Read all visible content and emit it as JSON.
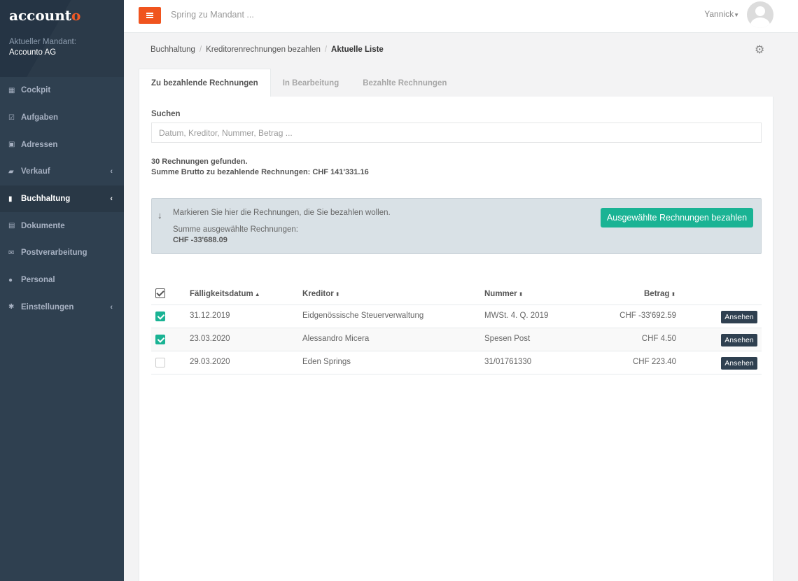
{
  "brand": {
    "logo_main": "account",
    "logo_accent": "o"
  },
  "sidebar": {
    "mandant_label": "Aktueller Mandant:",
    "mandant_name": "Accounto AG",
    "items": [
      {
        "label": "Cockpit",
        "icon": "grid-icon"
      },
      {
        "label": "Aufgaben",
        "icon": "check-square-icon"
      },
      {
        "label": "Adressen",
        "icon": "address-book-icon"
      },
      {
        "label": "Verkauf",
        "icon": "folder-open-icon"
      },
      {
        "label": "Buchhaltung",
        "icon": "book-icon"
      },
      {
        "label": "Dokumente",
        "icon": "file-icon"
      },
      {
        "label": "Postverarbeitung",
        "icon": "envelope-icon"
      },
      {
        "label": "Personal",
        "icon": "user-icon"
      },
      {
        "label": "Einstellungen",
        "icon": "cog-icon"
      }
    ]
  },
  "topbar": {
    "search_placeholder": "Spring zu Mandant ...",
    "user": "Yannick"
  },
  "breadcrumb": {
    "items": [
      "Buchhaltung",
      "Kreditorenrechnungen bezahlen"
    ],
    "current": "Aktuelle Liste"
  },
  "tabs": [
    {
      "label": "Zu bezahlende Rechnungen"
    },
    {
      "label": "In Bearbeitung"
    },
    {
      "label": "Bezahlte Rechnungen"
    }
  ],
  "search": {
    "label": "Suchen",
    "placeholder": "Datum, Kreditor, Nummer, Betrag ..."
  },
  "summary": {
    "found": "30 Rechnungen gefunden.",
    "total": "Summe Brutto zu bezahlende Rechnungen: CHF 141'331.16"
  },
  "info": {
    "text": "Markieren Sie hier die Rechnungen, die Sie bezahlen wollen.",
    "sum_label": "Summe ausgewählte Rechnungen:",
    "sum_value": "CHF -33'688.09",
    "button": "Ausgewählte Rechnungen bezahlen"
  },
  "table": {
    "headers": {
      "date": "Fälligkeitsdatum",
      "creditor": "Kreditor",
      "number": "Nummer",
      "amount": "Betrag"
    },
    "view_label": "Ansehen",
    "rows": [
      {
        "checked": true,
        "date": "31.12.2019",
        "creditor": "Eidgenössische Steuerverwaltung",
        "number": "MWSt. 4. Q. 2019",
        "amount": "CHF -33'692.59"
      },
      {
        "checked": true,
        "date": "23.03.2020",
        "creditor": "Alessandro Micera",
        "number": "Spesen Post",
        "amount": "CHF 4.50"
      },
      {
        "checked": false,
        "date": "29.03.2020",
        "creditor": "Eden Springs",
        "number": "31/01761330",
        "amount": "CHF 223.40"
      }
    ]
  },
  "colors": {
    "accent": "#f0541e",
    "primary": "#1ab394",
    "sidebar": "#2f4050"
  }
}
